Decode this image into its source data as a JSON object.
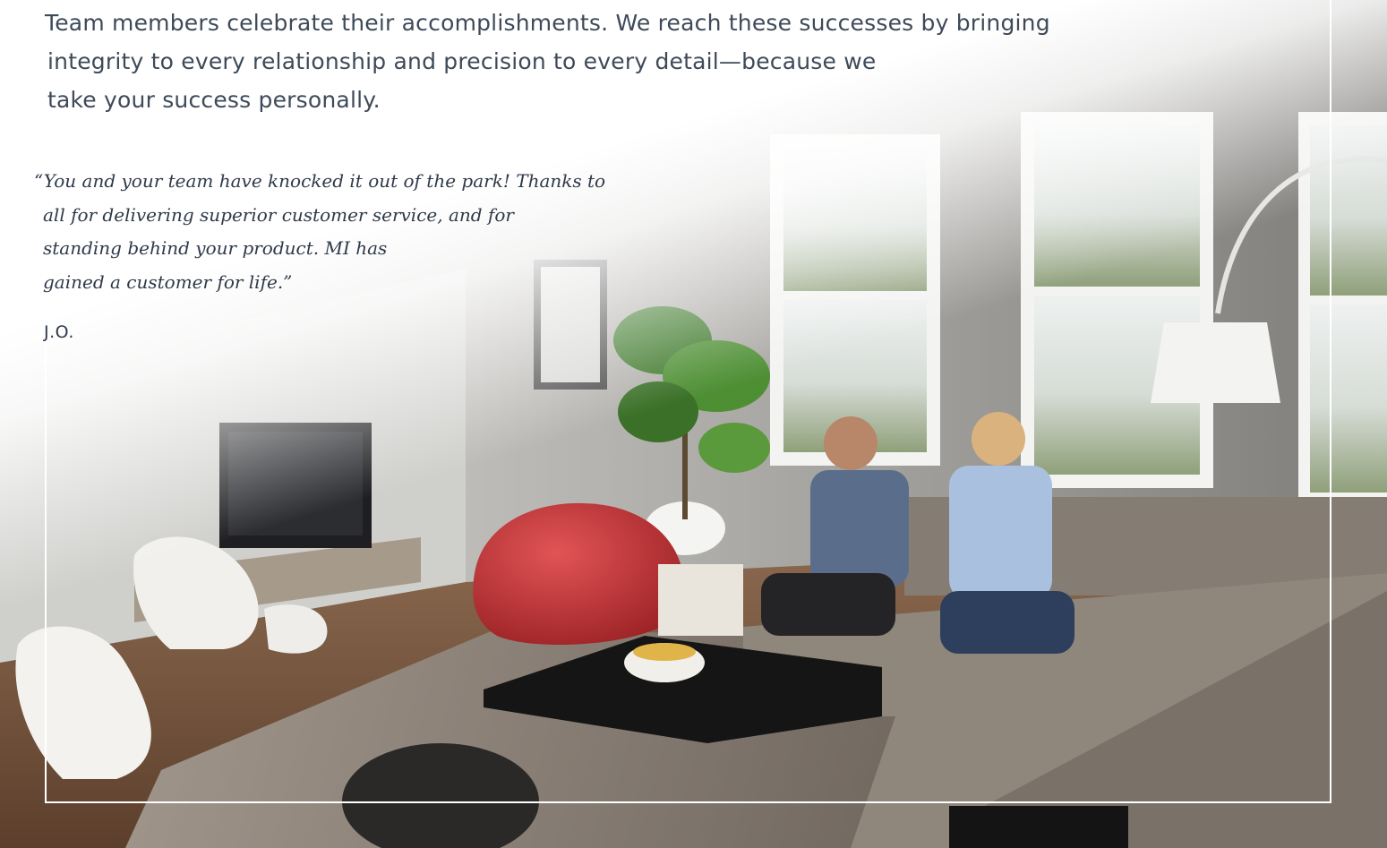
{
  "intro": {
    "lines": [
      "Team members celebrate their accomplishments. We reach these successes by bringing",
      "integrity to every relationship and precision to every detail—because we",
      "take your success personally."
    ]
  },
  "testimonial": {
    "quote_lines": [
      "“You and your team have knocked it out of the park! Thanks to",
      "all for delivering superior customer service, and for",
      "standing behind your product. MI has",
      "gained a customer for life.”"
    ],
    "author": "J.O."
  },
  "colors": {
    "text": "#3e4a59",
    "wall": "#8d8b88",
    "window_light": "#e8ebe8",
    "beanbag": "#c8383a",
    "sofa": "#8a8178",
    "floor": "#7a5a43"
  },
  "photo": {
    "icons": [
      "beanbag",
      "sofa",
      "coffee-table",
      "plant",
      "floor-lamp",
      "television",
      "chairs",
      "windows",
      "people"
    ]
  }
}
